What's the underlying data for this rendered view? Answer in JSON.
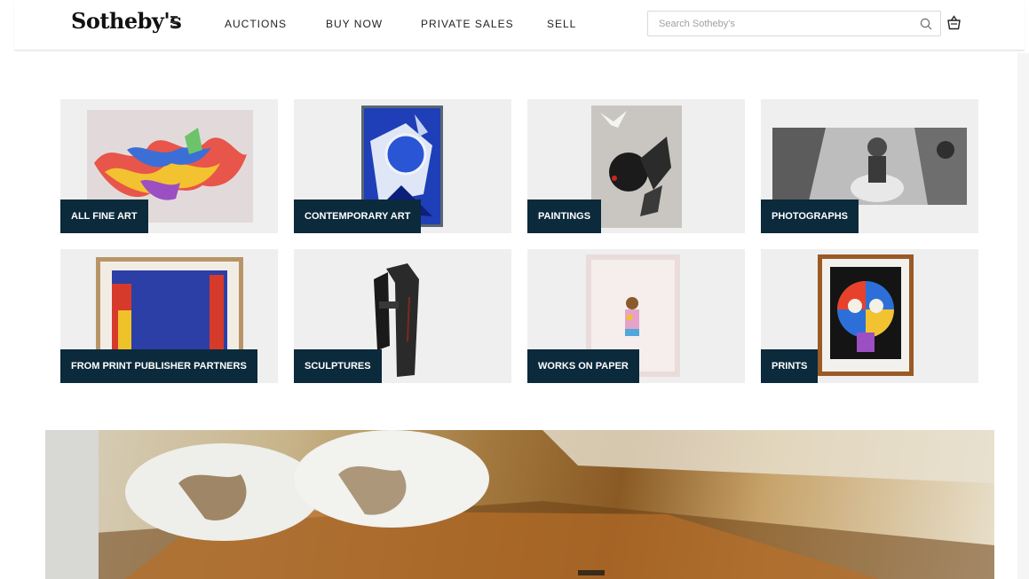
{
  "header": {
    "logo": "Sotheby's",
    "nav": [
      "AUCTIONS",
      "BUY NOW",
      "PRIVATE SALES",
      "SELL"
    ],
    "search_placeholder": "Search Sotheby's"
  },
  "categories": [
    {
      "label": "ALL FINE ART"
    },
    {
      "label": "CONTEMPORARY ART"
    },
    {
      "label": "PAINTINGS"
    },
    {
      "label": "PHOTOGRAPHS"
    },
    {
      "label": "FROM PRINT PUBLISHER PARTNERS"
    },
    {
      "label": "SCULPTURES"
    },
    {
      "label": "WORKS ON PAPER"
    },
    {
      "label": "PRINTS"
    }
  ],
  "colors": {
    "label_background": "#0b2a3b",
    "card_background": "#efefef"
  }
}
